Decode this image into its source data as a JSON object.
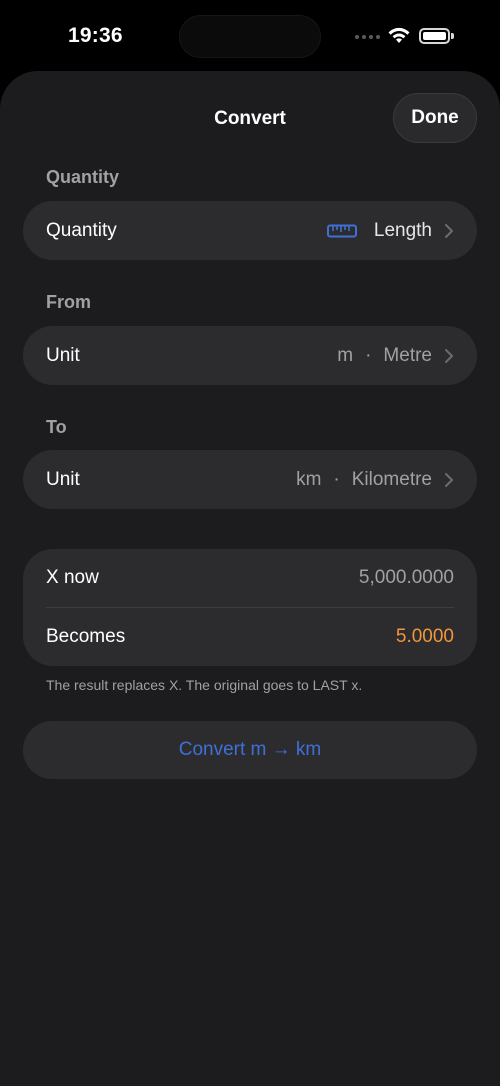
{
  "status": {
    "time": "19:36"
  },
  "header": {
    "title": "Convert",
    "done_label": "Done"
  },
  "quantity": {
    "section_label": "Quantity",
    "row_label": "Quantity",
    "value": "Length",
    "icon": "ruler-icon"
  },
  "from": {
    "section_label": "From",
    "row_label": "Unit",
    "symbol": "m",
    "separator": "·",
    "name": "Metre"
  },
  "to": {
    "section_label": "To",
    "row_label": "Unit",
    "symbol": "km",
    "separator": "·",
    "name": "Kilometre"
  },
  "preview": {
    "x_now_label": "X now",
    "x_now_value": "5,000.0000",
    "becomes_label": "Becomes",
    "becomes_value": "5.0000"
  },
  "note": "The result replaces X. The original goes to LAST x.",
  "convert_button": "Convert m → km",
  "colors": {
    "accent": "#3f6fd8",
    "result": "#f0963c",
    "sheet": "#1c1c1e",
    "row": "#2c2c2e"
  }
}
